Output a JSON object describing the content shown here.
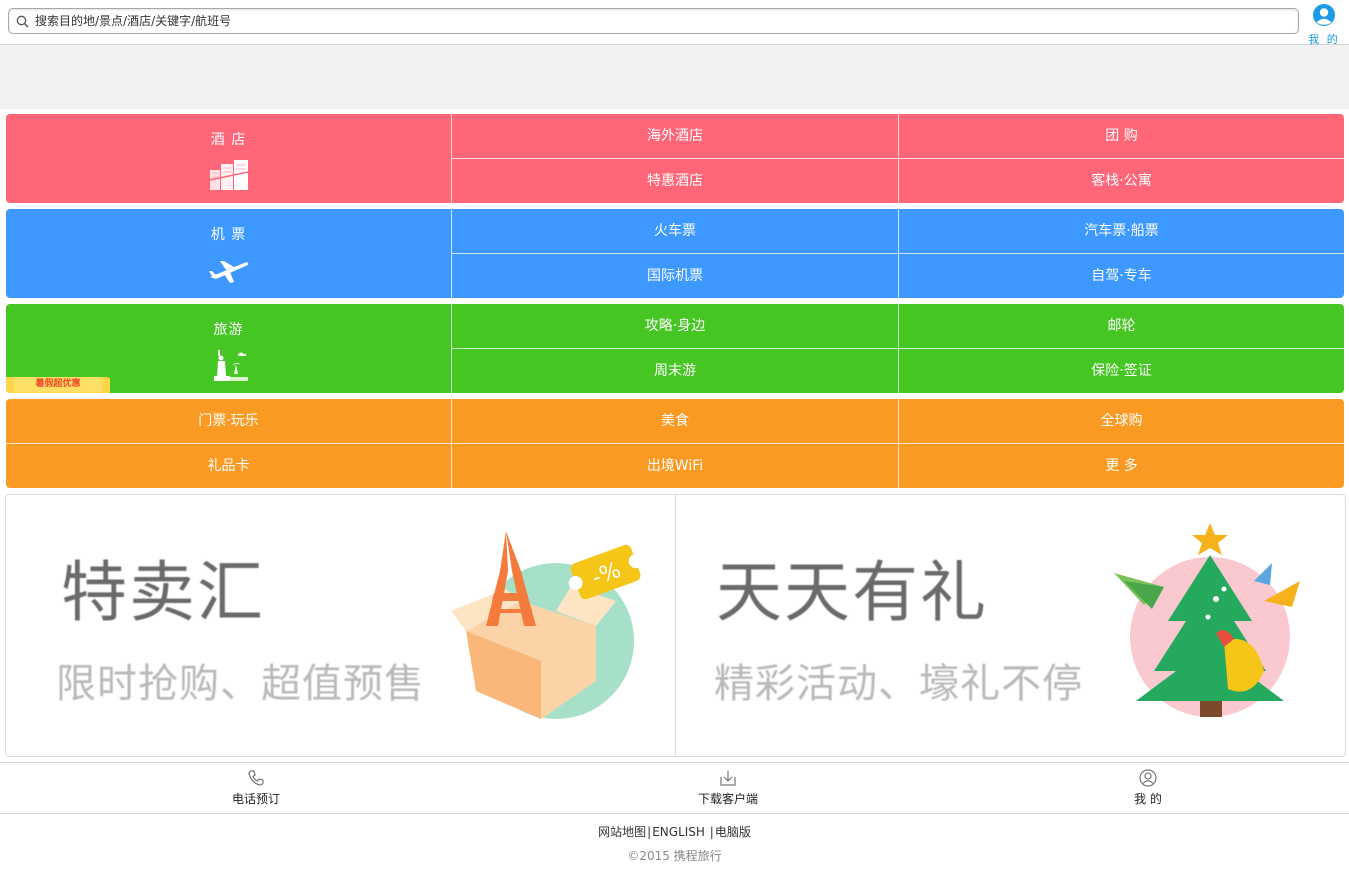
{
  "search": {
    "placeholder": "搜索目的地/景点/酒店/关键字/航班号",
    "icon": "search-icon"
  },
  "header": {
    "me_label": "我 的",
    "me_icon": "user-icon"
  },
  "colors": {
    "hotel": "#ff6678",
    "flight": "#3d98ff",
    "travel": "#45c623",
    "more": "#fb9a23",
    "accent": "#1a9be5"
  },
  "categories": {
    "hotel": {
      "title": "酒 店",
      "icon": "hotel-building-icon",
      "links": [
        "海外酒店",
        "团 购",
        "特惠酒店",
        "客栈·公寓"
      ]
    },
    "flight": {
      "title": "机 票",
      "icon": "airplane-icon",
      "links": [
        "火车票",
        "汽车票·船票",
        "国际机票",
        "自驾·专车"
      ]
    },
    "travel": {
      "title": "旅游",
      "icon": "statue-of-liberty-icon",
      "promo": "暑假超优惠",
      "links": [
        "攻略·身边",
        "邮轮",
        "周末游",
        "保险·签证"
      ]
    },
    "more": {
      "links": [
        "门票·玩乐",
        "美食",
        "全球购",
        "礼品卡",
        "出境WiFi",
        "更 多"
      ]
    }
  },
  "banners": [
    {
      "title": "特卖汇",
      "subtitle": "限时抢购、超值预售",
      "icon": "gift-box-eiffel-icon"
    },
    {
      "title": "天天有礼",
      "subtitle": "精彩活动、壕礼不停",
      "icon": "christmas-tree-icon"
    }
  ],
  "bottombar": [
    {
      "label": "电话预订",
      "icon": "phone-icon"
    },
    {
      "label": "下载客户端",
      "icon": "download-icon"
    },
    {
      "label": "我 的",
      "icon": "user-icon"
    }
  ],
  "footer": {
    "links": [
      "网站地图",
      "ENGLISH",
      "电脑版"
    ],
    "copyright": "©2015 携程旅行"
  }
}
